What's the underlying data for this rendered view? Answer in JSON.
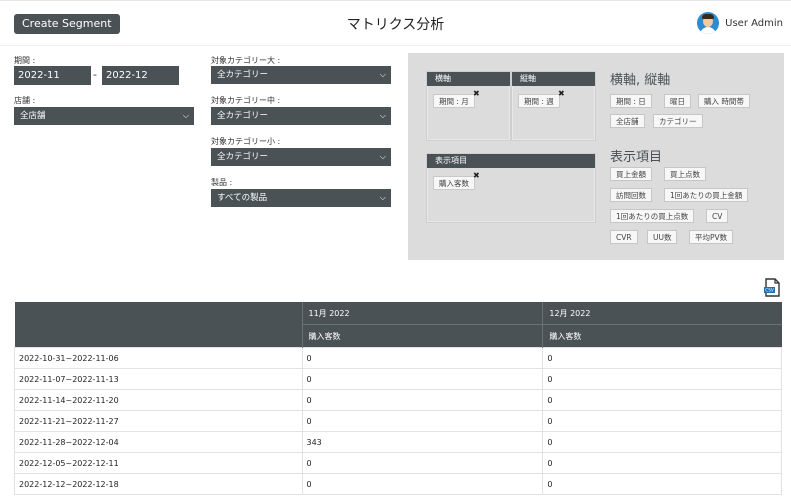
{
  "header": {
    "segment_button": "Create Segment",
    "title": "マトリクス分析",
    "user_name": "User Admin"
  },
  "filters": {
    "period_label": "期間 :",
    "period_from": "2022-11",
    "period_sep": "-",
    "period_to": "2022-12",
    "store_label": "店舗 :",
    "store_value": "全店舗",
    "cat_large_label": "対象カテゴリー大 :",
    "cat_large_value": "全カテゴリー",
    "cat_mid_label": "対象カテゴリー中 :",
    "cat_mid_value": "全カテゴリー",
    "cat_small_label": "対象カテゴリー小 :",
    "cat_small_value": "全カテゴリー",
    "product_label": "製品 :",
    "product_value": "すべての製品"
  },
  "config": {
    "x_axis_head": "横軸",
    "x_axis_chip": "期間 : 月",
    "y_axis_head": "縦軸",
    "y_axis_chip": "期間 : 週",
    "display_head": "表示項目",
    "display_chip": "購入客数",
    "axes_section": "横軸, 縦軸",
    "axes_options": [
      "期間 : 日",
      "曜日",
      "購入 時間帯",
      "全店舗",
      "カテゴリー"
    ],
    "metrics_section": "表示項目",
    "metric_options": [
      "買上金額",
      "買上点数",
      "訪問回数",
      "1回あたりの買上金額",
      "1回あたりの買上点数",
      "CV",
      "CVR",
      "UU数",
      "平均PV数"
    ]
  },
  "table": {
    "months": [
      "11月 2022",
      "12月 2022"
    ],
    "metric": [
      "購入客数",
      "購入客数"
    ],
    "rows": [
      [
        "2022-10-31~2022-11-06",
        "0",
        "0"
      ],
      [
        "2022-11-07~2022-11-13",
        "0",
        "0"
      ],
      [
        "2022-11-14~2022-11-20",
        "0",
        "0"
      ],
      [
        "2022-11-21~2022-11-27",
        "0",
        "0"
      ],
      [
        "2022-11-28~2022-12-04",
        "343",
        "0"
      ],
      [
        "2022-12-05~2022-12-11",
        "0",
        "0"
      ],
      [
        "2022-12-12~2022-12-18",
        "0",
        "0"
      ]
    ]
  },
  "icons": {
    "csv": "csv-download-icon",
    "chevron": "chevron-down-icon",
    "remove": "close-icon"
  }
}
